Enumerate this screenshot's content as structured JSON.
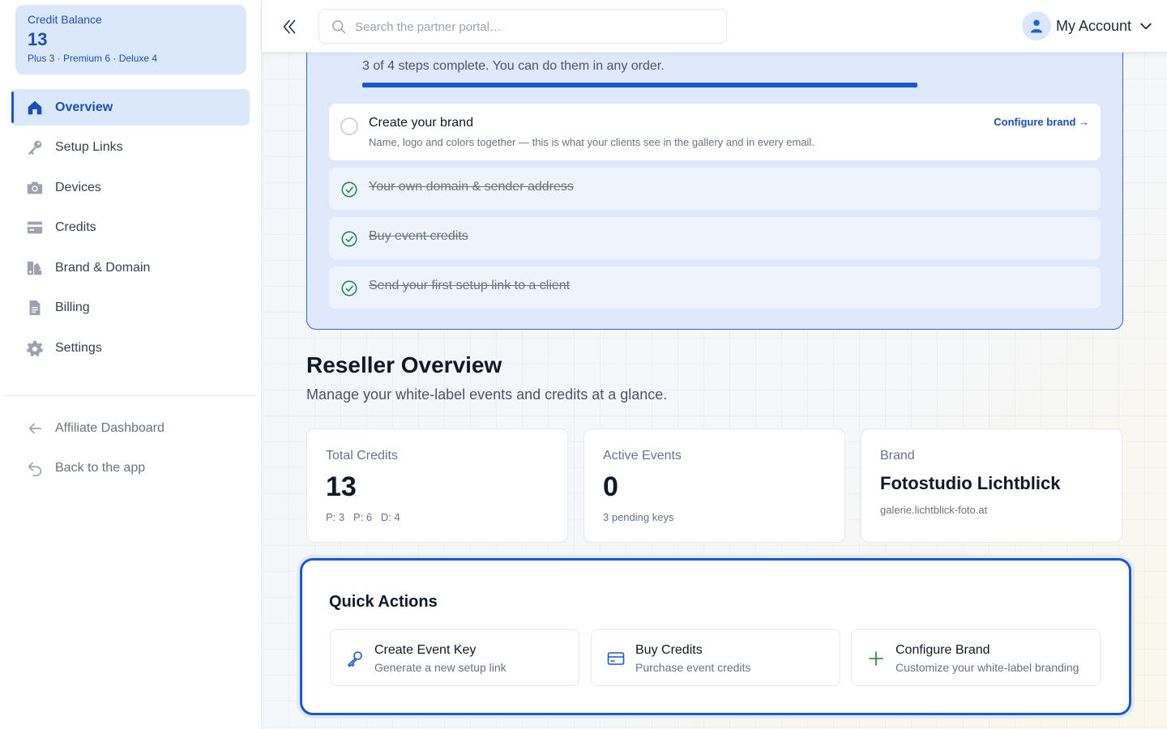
{
  "sidebar": {
    "credit_balance": {
      "label": "Credit Balance",
      "value": "13",
      "breakdown": "Plus 3 · Premium 6 · Deluxe 4"
    },
    "items": [
      {
        "label": "Overview",
        "icon": "home-icon",
        "active": true
      },
      {
        "label": "Setup Links",
        "icon": "key-icon"
      },
      {
        "label": "Devices",
        "icon": "camera-icon"
      },
      {
        "label": "Credits",
        "icon": "credit-card-icon"
      },
      {
        "label": "Brand & Domain",
        "icon": "palette-icon"
      },
      {
        "label": "Billing",
        "icon": "invoice-icon"
      },
      {
        "label": "Settings",
        "icon": "gear-icon"
      }
    ],
    "secondary": [
      {
        "label": "Affiliate Dashboard",
        "icon": "arrow-left-icon"
      },
      {
        "label": "Back to the app",
        "icon": "return-icon"
      }
    ]
  },
  "header": {
    "search_placeholder": "Search the partner portal…",
    "account_label": "My Account"
  },
  "setup": {
    "progress_text": "3 of 4 steps complete. You can do them in any order.",
    "progress_fraction": 0.75,
    "steps": [
      {
        "title": "Create your brand",
        "description": "Name, logo and colors together — this is what your clients see in the gallery and in every email.",
        "action": "Configure brand →",
        "done": false
      },
      {
        "title": "Your own domain & sender address",
        "done": true
      },
      {
        "title": "Buy event credits",
        "done": true
      },
      {
        "title": "Send your first setup link to a client",
        "done": true
      }
    ]
  },
  "overview": {
    "title": "Reseller Overview",
    "subtitle": "Manage your white-label events and credits at a glance.",
    "stats": [
      {
        "label": "Total Credits",
        "value": "13",
        "sub": "P: 3   P: 6   D: 4"
      },
      {
        "label": "Active Events",
        "value": "0",
        "sub": "3 pending keys"
      },
      {
        "label": "Brand",
        "value": "Fotostudio Lichtblick",
        "sub": "galerie.lichtblick-foto.at"
      }
    ]
  },
  "quick_actions": {
    "title": "Quick Actions",
    "items": [
      {
        "label": "Create Event Key",
        "description": "Generate a new setup link",
        "icon": "key-icon"
      },
      {
        "label": "Buy Credits",
        "description": "Purchase event credits",
        "icon": "credit-card-icon"
      },
      {
        "label": "Configure Brand",
        "description": "Customize your white-label branding",
        "icon": "plus-icon"
      }
    ]
  },
  "colors": {
    "accent": "#1d56d4",
    "accent_light": "#dbe8fb",
    "success": "#15803d"
  }
}
